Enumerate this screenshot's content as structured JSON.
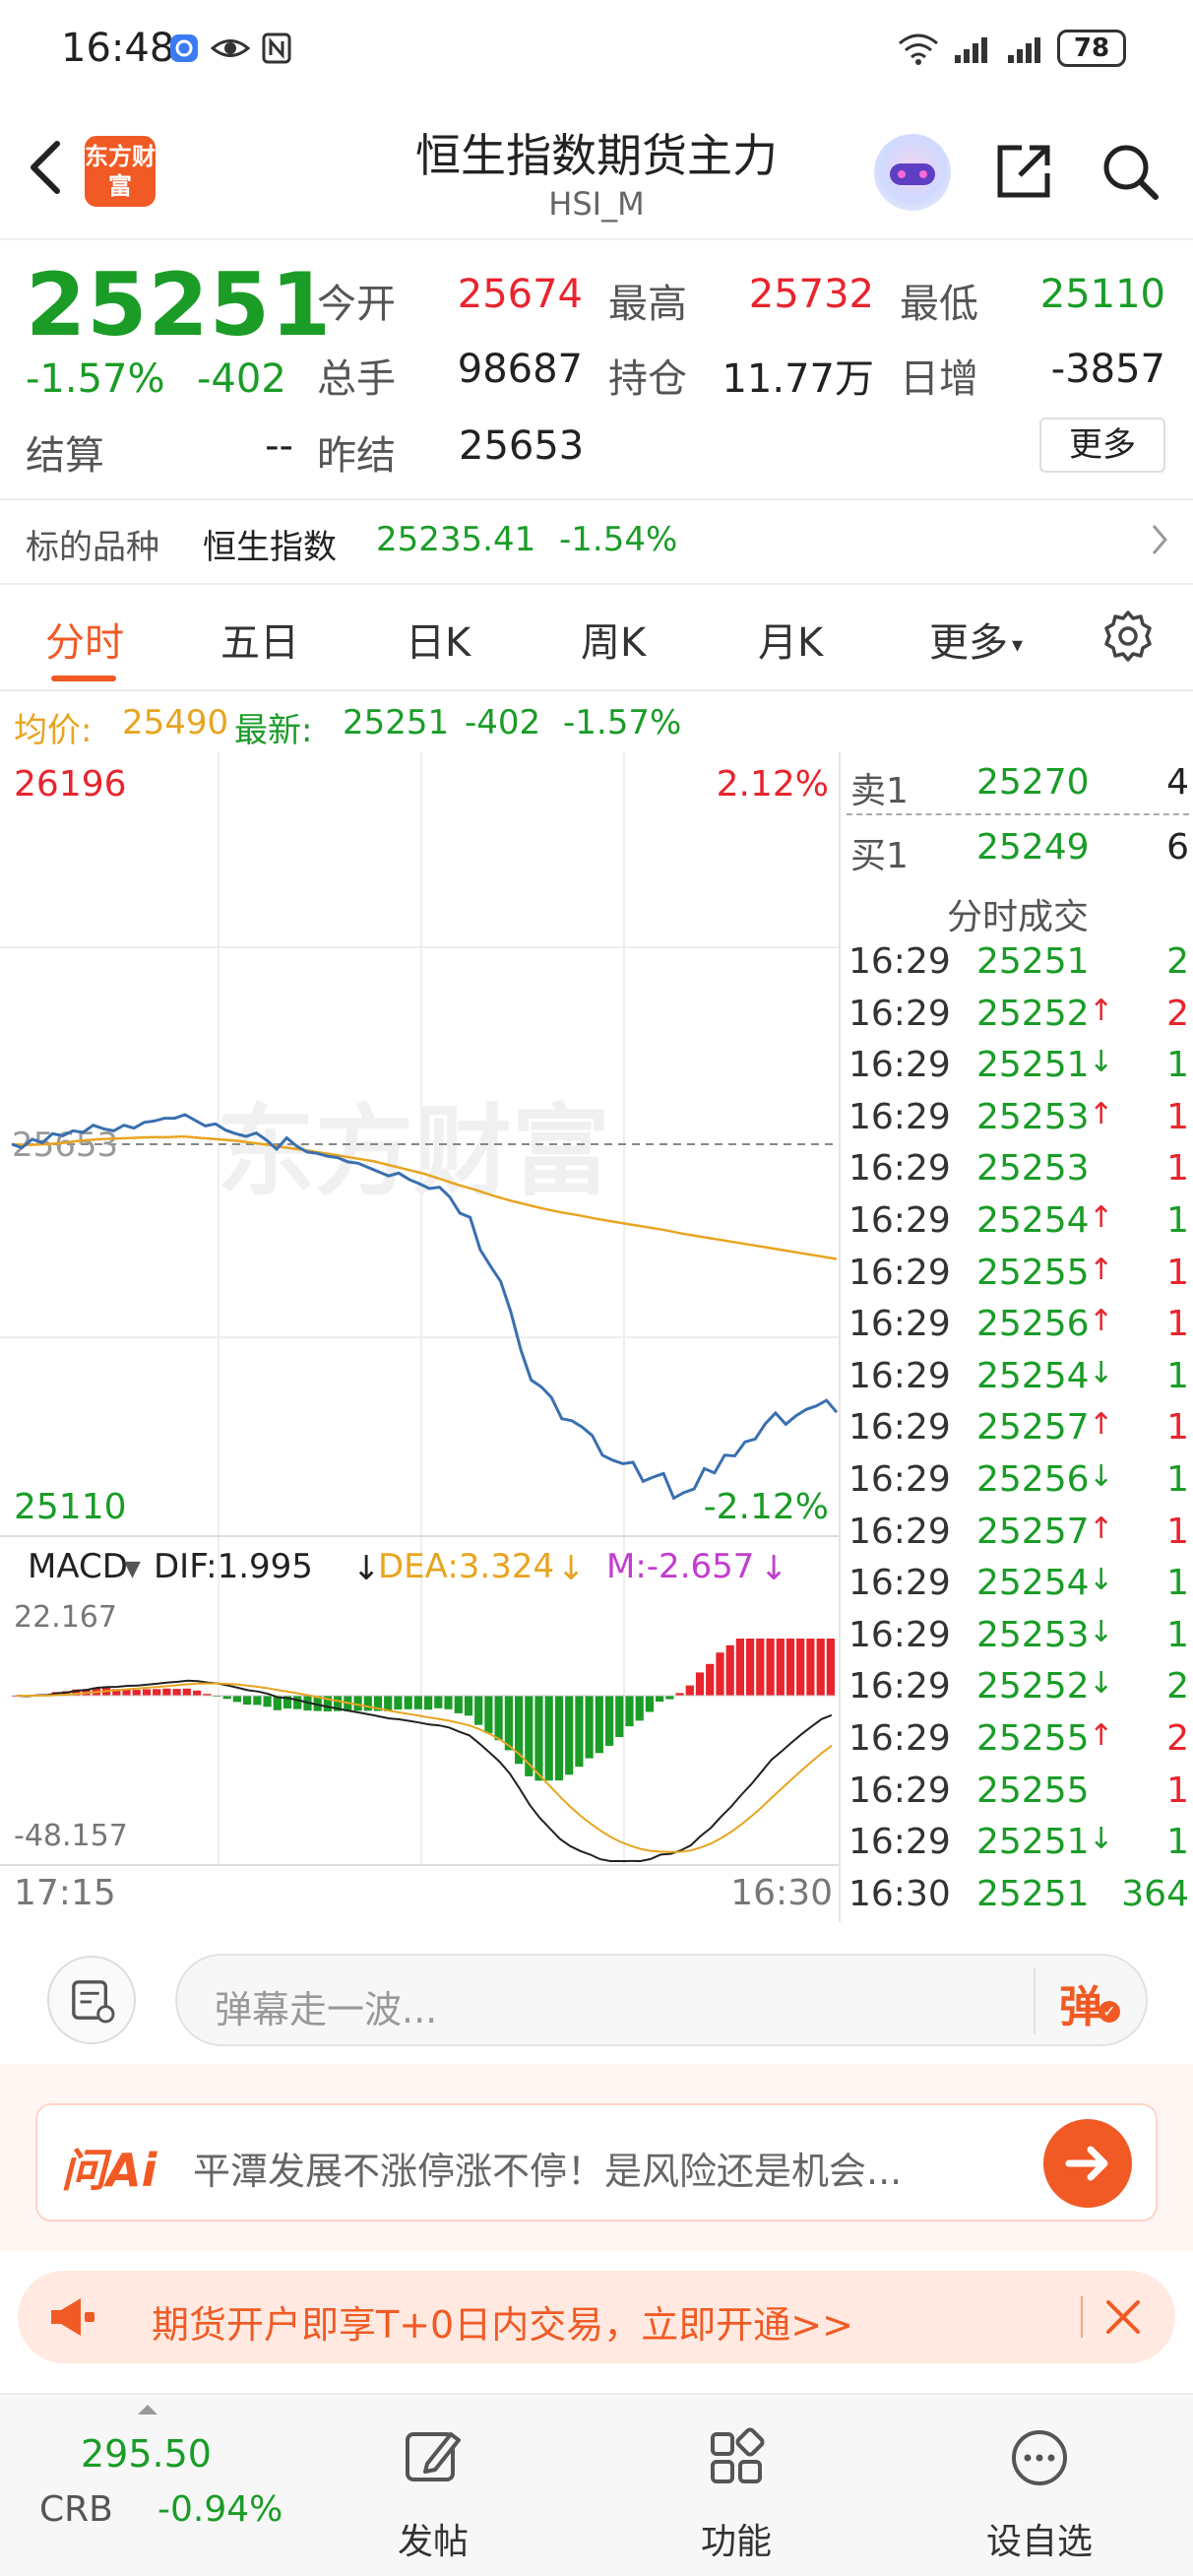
{
  "status_bar": {
    "time": "16:48",
    "battery": "78"
  },
  "header": {
    "title": "恒生指数期货主力",
    "subtitle": "HSI_M",
    "logo_text": "东方财富"
  },
  "quote": {
    "last": "25251",
    "chg_pct": "-1.57%",
    "chg_abs": "-402",
    "rows": [
      [
        {
          "label": "今开",
          "value": "25674",
          "color": "#e8242d"
        },
        {
          "label": "最高",
          "value": "25732",
          "color": "#e8242d"
        },
        {
          "label": "最低",
          "value": "25110",
          "color": "#1a9c27"
        }
      ],
      [
        {
          "label": "总手",
          "value": "98687",
          "color": "#222222"
        },
        {
          "label": "持仓",
          "value": "11.77万",
          "color": "#222222"
        },
        {
          "label": "日增",
          "value": "-3857",
          "color": "#222222"
        }
      ],
      [
        {
          "label": "结算",
          "value": "--",
          "color": "#222222"
        },
        {
          "label": "昨结",
          "value": "25653",
          "color": "#222222"
        }
      ]
    ],
    "more_label": "更多"
  },
  "underlying": {
    "label": "标的品种",
    "name": "恒生指数",
    "price": "25235.41",
    "chg": "-1.54%"
  },
  "tabs": [
    "分时",
    "五日",
    "日K",
    "周K",
    "月K",
    "更多"
  ],
  "avg_row": {
    "avg_label": "均价:",
    "avg_value": "25490",
    "latest_label": "最新:",
    "latest_value": "25251",
    "latest_chg": "-402",
    "latest_pct": "-1.57%"
  },
  "chart": {
    "y_max_label": "26196",
    "y_min_label": "25110",
    "pct_max_label": "2.12%",
    "pct_min_label": "-2.12%",
    "ref_label": "25653",
    "watermark": "东方财富",
    "time_start": "17:15",
    "time_end": "16:30",
    "macd_label": "MACD",
    "dif": "DIF:1.995",
    "dea": "DEA:3.324",
    "m": "M:-2.657",
    "macd_max": "22.167",
    "macd_min": "-48.157",
    "colors": {
      "price": "#3a6fb0",
      "avg": "#e8a420",
      "up": "#e8242d",
      "down": "#1a9c27"
    }
  },
  "chart_data": {
    "type": "line",
    "ylim": [
      25110,
      26196
    ],
    "reference": 25653,
    "series": [
      {
        "name": "最新",
        "values": [
          25653,
          25648,
          25660,
          25655,
          25668,
          25665,
          25672,
          25670,
          25680,
          25675,
          25672,
          25680,
          25676,
          25684,
          25686,
          25690,
          25690,
          25695,
          25687,
          25679,
          25682,
          25673,
          25668,
          25664,
          25669,
          25659,
          25646,
          25662,
          25650,
          25642,
          25640,
          25636,
          25634,
          25628,
          25626,
          25620,
          25614,
          25608,
          25612,
          25603,
          25597,
          25590,
          25592,
          25578,
          25555,
          25549,
          25503,
          25480,
          25458,
          25415,
          25360,
          25318,
          25308,
          25293,
          25263,
          25260,
          25251,
          25239,
          25211,
          25204,
          25199,
          25201,
          25174,
          25180,
          25185,
          25150,
          25158,
          25163,
          25192,
          25186,
          25211,
          25210,
          25230,
          25234,
          25256,
          25271,
          25255,
          25267,
          25276,
          25281,
          25289,
          25272
        ]
      },
      {
        "name": "均价",
        "values": [
          25653,
          25652,
          25653,
          25655,
          25658,
          25660,
          25661,
          25662,
          25663,
          25663,
          25664,
          25662,
          25660,
          25658,
          25655,
          25652,
          25648,
          25645,
          25641,
          25637,
          25633,
          25629,
          25623,
          25617,
          25611,
          25603,
          25595,
          25588,
          25580,
          25573,
          25567,
          25561,
          25556,
          25552,
          25547,
          25543,
          25539,
          25535,
          25531,
          25526,
          25522,
          25518,
          25514,
          25510,
          25506,
          25502,
          25498,
          25494,
          25490
        ]
      }
    ]
  },
  "order_book": [
    {
      "label": "卖1",
      "price": "25270",
      "vol": "4"
    },
    {
      "label": "买1",
      "price": "25249",
      "vol": "6"
    }
  ],
  "ticks_title": "分时成交",
  "ticks": [
    {
      "time": "16:29",
      "price": "25251",
      "dir": "",
      "vol": "2",
      "vol_color": "#1a9c27"
    },
    {
      "time": "16:29",
      "price": "25252",
      "dir": "up",
      "vol": "2",
      "vol_color": "#e8242d"
    },
    {
      "time": "16:29",
      "price": "25251",
      "dir": "down",
      "vol": "1",
      "vol_color": "#1a9c27"
    },
    {
      "time": "16:29",
      "price": "25253",
      "dir": "up",
      "vol": "1",
      "vol_color": "#e8242d"
    },
    {
      "time": "16:29",
      "price": "25253",
      "dir": "",
      "vol": "1",
      "vol_color": "#e8242d"
    },
    {
      "time": "16:29",
      "price": "25254",
      "dir": "up",
      "vol": "1",
      "vol_color": "#1a9c27"
    },
    {
      "time": "16:29",
      "price": "25255",
      "dir": "up",
      "vol": "1",
      "vol_color": "#e8242d"
    },
    {
      "time": "16:29",
      "price": "25256",
      "dir": "up",
      "vol": "1",
      "vol_color": "#e8242d"
    },
    {
      "time": "16:29",
      "price": "25254",
      "dir": "down",
      "vol": "1",
      "vol_color": "#1a9c27"
    },
    {
      "time": "16:29",
      "price": "25257",
      "dir": "up",
      "vol": "1",
      "vol_color": "#e8242d"
    },
    {
      "time": "16:29",
      "price": "25256",
      "dir": "down",
      "vol": "1",
      "vol_color": "#1a9c27"
    },
    {
      "time": "16:29",
      "price": "25257",
      "dir": "up",
      "vol": "1",
      "vol_color": "#e8242d"
    },
    {
      "time": "16:29",
      "price": "25254",
      "dir": "down",
      "vol": "1",
      "vol_color": "#1a9c27"
    },
    {
      "time": "16:29",
      "price": "25253",
      "dir": "down",
      "vol": "1",
      "vol_color": "#1a9c27"
    },
    {
      "time": "16:29",
      "price": "25252",
      "dir": "down",
      "vol": "2",
      "vol_color": "#1a9c27"
    },
    {
      "time": "16:29",
      "price": "25255",
      "dir": "up",
      "vol": "2",
      "vol_color": "#e8242d"
    },
    {
      "time": "16:29",
      "price": "25255",
      "dir": "",
      "vol": "1",
      "vol_color": "#e8242d"
    },
    {
      "time": "16:29",
      "price": "25251",
      "dir": "down",
      "vol": "1",
      "vol_color": "#1a9c27"
    },
    {
      "time": "16:30",
      "price": "25251",
      "dir": "",
      "vol": "364",
      "vol_color": "#1a9c27"
    }
  ],
  "comment": {
    "placeholder": "弹幕走一波...",
    "send_label": "弹"
  },
  "ai": {
    "logo": "问Ai",
    "prompt": "平潭发展不涨停涨不停！是风险还是机会..."
  },
  "promo": {
    "text": "期货开户即享T+0日内交易，立即开通>>"
  },
  "bottom_nav": {
    "ticker_price": "295.50",
    "ticker_name": "CRB",
    "ticker_chg": "-0.94%",
    "items": [
      "发帖",
      "功能",
      "设自选"
    ]
  }
}
